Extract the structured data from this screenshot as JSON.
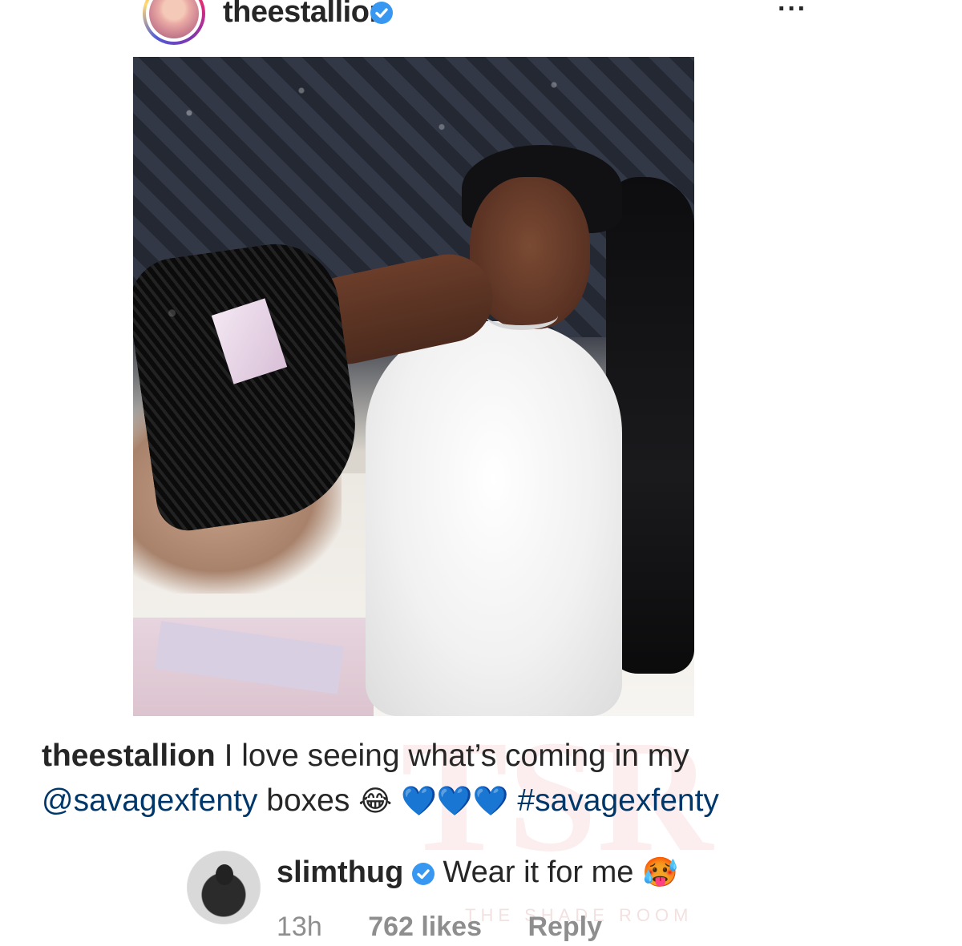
{
  "post": {
    "username": "theestallion",
    "verified": true,
    "more_label": "···"
  },
  "caption": {
    "username": "theestallion",
    "text_1": "I love seeing what’s coming in my",
    "mention": "@savagexfenty",
    "text_2": "boxes",
    "emoji_laugh": "😂",
    "emoji_hearts": "💙💙💙",
    "hashtag": "#savagexfenty"
  },
  "comment": {
    "username": "slimthug",
    "verified": true,
    "text": "Wear it for me",
    "emoji": "🥵",
    "time": "13h",
    "likes": "762 likes",
    "reply_label": "Reply"
  },
  "watermark": {
    "logo": "TSR",
    "text": "THE SHADE ROOM"
  },
  "icons": {
    "verified": "verified-badge-icon",
    "more": "more-options-icon"
  },
  "colors": {
    "verified": "#3897f0",
    "link": "#00376b",
    "meta": "#8e8e8e"
  }
}
